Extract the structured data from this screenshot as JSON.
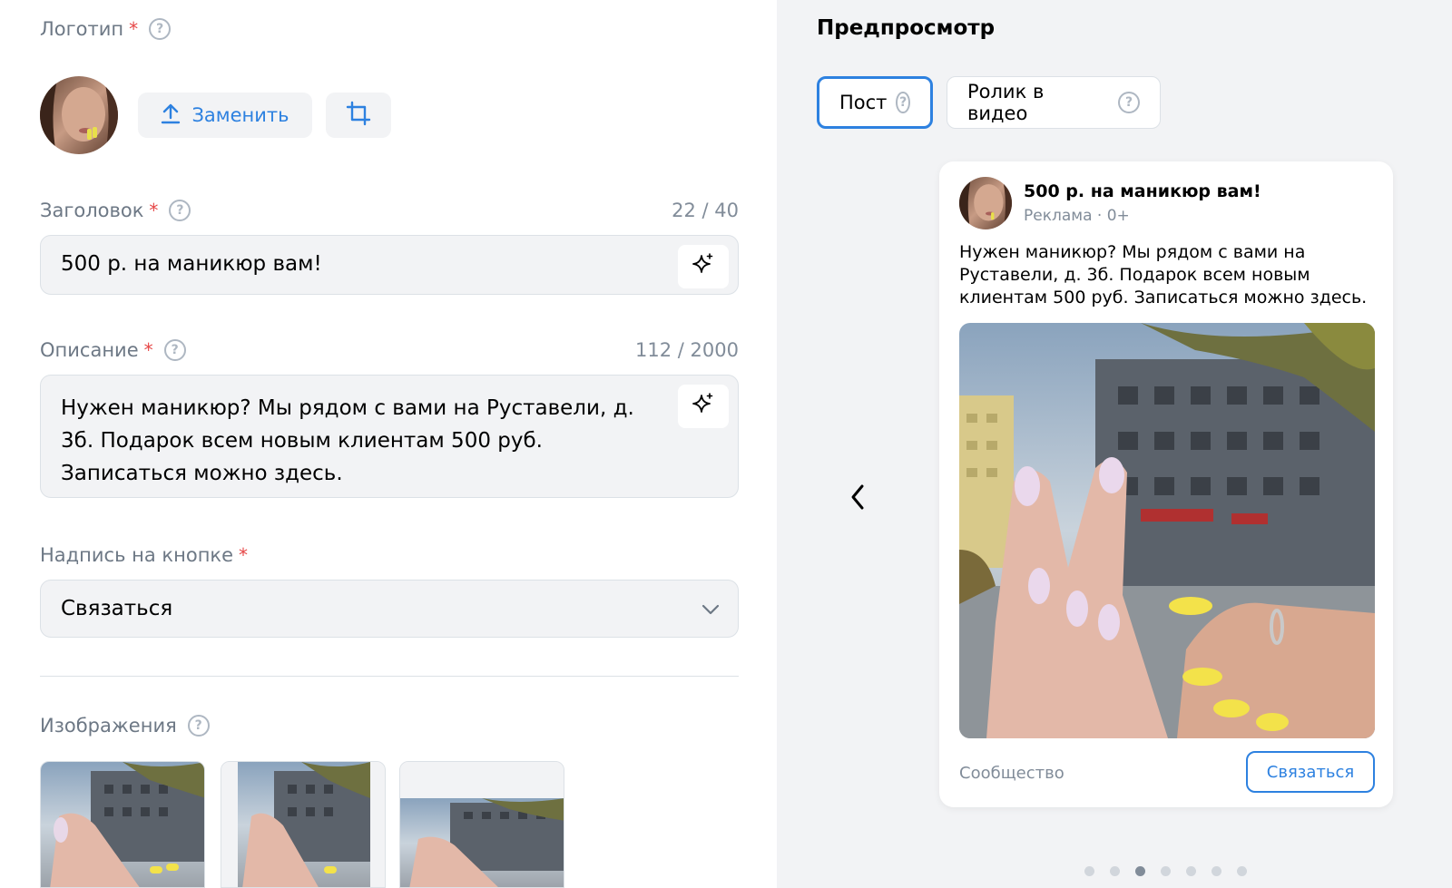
{
  "logo": {
    "label": "Логотип",
    "required": "*",
    "replace_label": "Заменить"
  },
  "headline": {
    "label": "Заголовок",
    "required": "*",
    "counter": "22 / 40",
    "value": "500 р. на маникюр вам!"
  },
  "description": {
    "label": "Описание",
    "required": "*",
    "counter": "112 / 2000",
    "line1": "Нужен маникюр? Мы рядом с вами на Руставели, д.",
    "line2": "3б. Подарок всем новым клиентам 500 руб.",
    "line3": "Записаться можно здесь."
  },
  "button_caption": {
    "label": "Надпись на кнопке",
    "required": "*",
    "value": "Связаться"
  },
  "images": {
    "label": "Изображения"
  },
  "preview": {
    "title": "Предпросмотр",
    "tabs": [
      {
        "label": "Пост",
        "active": true
      },
      {
        "label": "Ролик в видео",
        "active": false
      }
    ],
    "card": {
      "title": "500 р. на маникюр вам!",
      "subtitle": "Реклама · 0+",
      "text": "Нужен маникюр? Мы рядом с вами на Руставели, д. 3б. Подарок всем новым клиентам 500 руб. Записаться можно здесь.",
      "community": "Сообщество",
      "cta": "Связаться"
    },
    "dots_count": 7,
    "active_dot": 3
  },
  "colors": {
    "accent": "#2d81e0",
    "required": "#e64646",
    "muted": "#818c99",
    "field_bg": "#f2f3f5"
  }
}
